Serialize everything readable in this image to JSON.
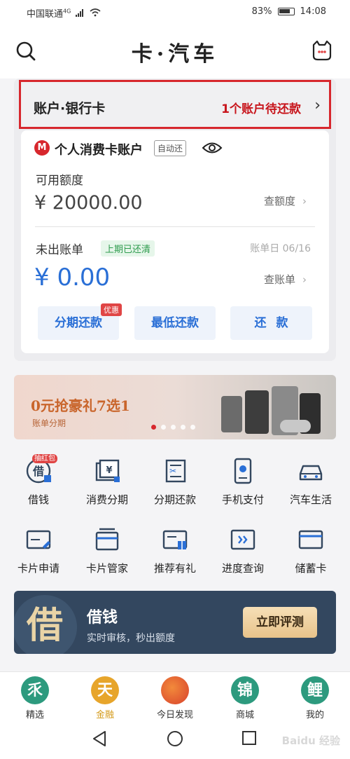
{
  "status_bar": {
    "carrier": "中国联通",
    "network": "4G",
    "battery": "83%",
    "time": "14:08"
  },
  "header": {
    "title": "卡·汽车"
  },
  "account": {
    "section_label": "账户·银行卡",
    "due_text": "1个账户待还款",
    "card_name": "个人消费卡账户",
    "auto_badge": "自动还",
    "available_label": "可用额度",
    "available_amount": "¥ 20000.00",
    "check_limit": "查额度",
    "unbilled_label": "未出账单",
    "cleared_badge": "上期已还清",
    "bill_day": "账单日 06/16",
    "unbilled_amount": "¥ 0.00",
    "check_bill": "查账单",
    "buttons": {
      "installment": "分期还款",
      "promo_badge": "优惠",
      "minimum": "最低还款",
      "repay": "还款"
    }
  },
  "banner": {
    "title": "0元抢豪礼7选1",
    "subtitle": "账单分期",
    "active_slide": 1,
    "slide_count": 5
  },
  "grid": {
    "row1": [
      {
        "label": "借钱",
        "icon": "borrow-icon",
        "badge": "抽红包"
      },
      {
        "label": "消费分期",
        "icon": "consumer-installment-icon"
      },
      {
        "label": "分期还款",
        "icon": "installment-repay-icon"
      },
      {
        "label": "手机支付",
        "icon": "mobile-pay-icon"
      },
      {
        "label": "汽车生活",
        "icon": "car-icon"
      }
    ],
    "row2": [
      {
        "label": "卡片申请",
        "icon": "card-apply-icon"
      },
      {
        "label": "卡片管家",
        "icon": "card-manager-icon"
      },
      {
        "label": "推荐有礼",
        "icon": "referral-gift-icon"
      },
      {
        "label": "进度查询",
        "icon": "progress-query-icon"
      },
      {
        "label": "储蓄卡",
        "icon": "debit-card-icon"
      }
    ]
  },
  "borrow_banner": {
    "char": "借",
    "title": "借钱",
    "subtitle": "实时审核，秒出额度",
    "button": "立即评测"
  },
  "tabs": [
    {
      "label": "精选",
      "glyph": "乑",
      "color": "#2d9a7e"
    },
    {
      "label": "金融",
      "glyph": "天",
      "color": "#e7a52b",
      "active": true
    },
    {
      "label": "今日发现",
      "glyph": "",
      "color": "#e05a3a"
    },
    {
      "label": "商城",
      "glyph": "锦",
      "color": "#2d9a7e"
    },
    {
      "label": "我的",
      "glyph": "鲤",
      "color": "#2d9a7e"
    }
  ],
  "watermark": "Baidu 经验",
  "colors": {
    "brand_red": "#d7272d",
    "link_blue": "#2a6fd6",
    "navy": "#33475f",
    "gold": "#e7a52b"
  }
}
